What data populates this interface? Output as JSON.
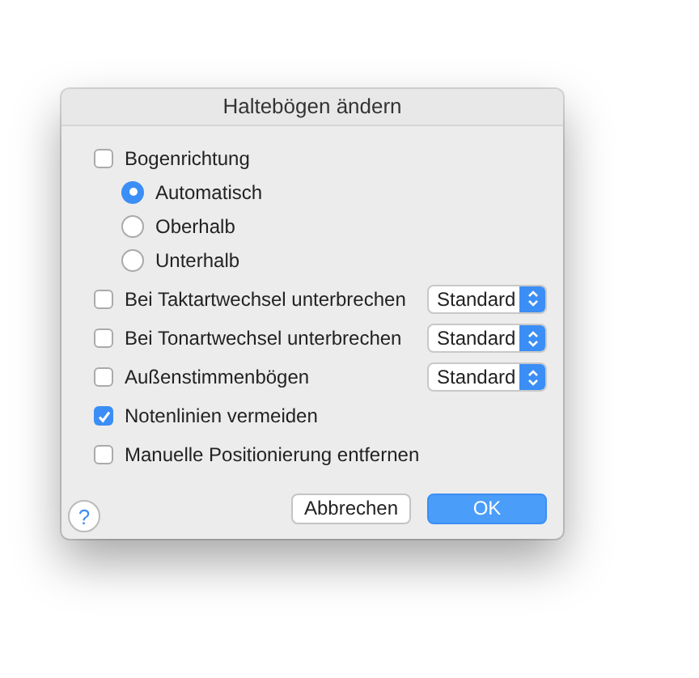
{
  "window": {
    "title": "Haltebögen ändern"
  },
  "options": [
    {
      "kind": "checkbox",
      "label": "Bogenrichtung",
      "checked": false
    },
    {
      "kind": "radio",
      "label": "Automatisch",
      "selected": true
    },
    {
      "kind": "radio",
      "label": "Oberhalb",
      "selected": false
    },
    {
      "kind": "radio",
      "label": "Unterhalb",
      "selected": false
    },
    {
      "kind": "select",
      "label": "Bei Taktartwechsel unterbrechen",
      "checked": false,
      "value": "Standard"
    },
    {
      "kind": "select",
      "label": "Bei Tonartwechsel unterbrechen",
      "checked": false,
      "value": "Standard"
    },
    {
      "kind": "select",
      "label": "Außenstimmenbögen",
      "checked": false,
      "value": "Standard"
    },
    {
      "kind": "checkbox",
      "label": "Notenlinien vermeiden",
      "checked": true
    },
    {
      "kind": "checkbox",
      "label": "Manuelle Positionierung entfernen",
      "checked": false
    }
  ],
  "help": "?",
  "buttons": [
    {
      "label": "Abbrechen",
      "kind": "secondary"
    },
    {
      "label": "OK",
      "kind": "primary"
    }
  ]
}
